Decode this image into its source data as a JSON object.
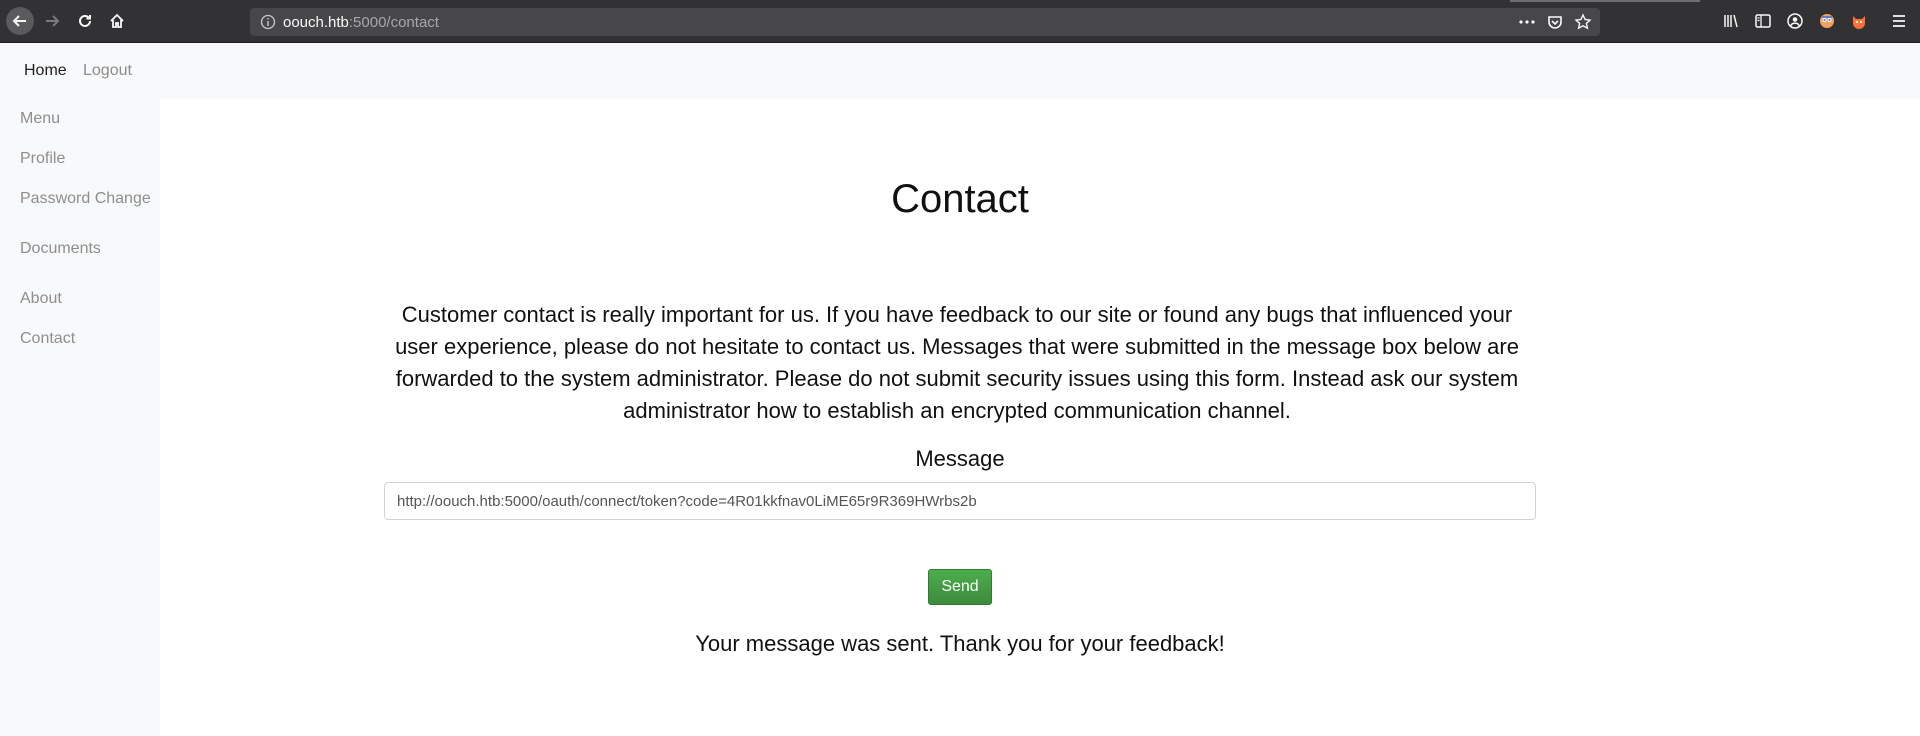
{
  "browser": {
    "url_host": "oouch.htb",
    "url_path": ":5000/contact"
  },
  "topnav": {
    "home": "Home",
    "logout": "Logout"
  },
  "sidebar": {
    "items": [
      {
        "label": "Menu"
      },
      {
        "label": "Profile"
      },
      {
        "label": "Password Change"
      },
      {
        "label": "Documents"
      },
      {
        "label": "About"
      },
      {
        "label": "Contact"
      }
    ]
  },
  "main": {
    "title": "Contact",
    "intro": "Customer contact is really important for us. If you have feedback to our site or found any bugs that influenced your user experience, please do not hesitate to contact us. Messages that were submitted in the message box below are forwarded to the system administrator. Please do not submit security issues using this form. Instead ask our system administrator how to establish an encrypted communication channel.",
    "message_label": "Message",
    "message_value": "http://oouch.htb:5000/oauth/connect/token?code=4R01kkfnav0LiME65r9R369HWrbs2b",
    "send_label": "Send",
    "status": "Your message was sent. Thank you for your feedback!"
  },
  "colors": {
    "send_button": "#43a047",
    "browser_chrome": "#323234",
    "nav_bg": "#f8f9fa"
  }
}
